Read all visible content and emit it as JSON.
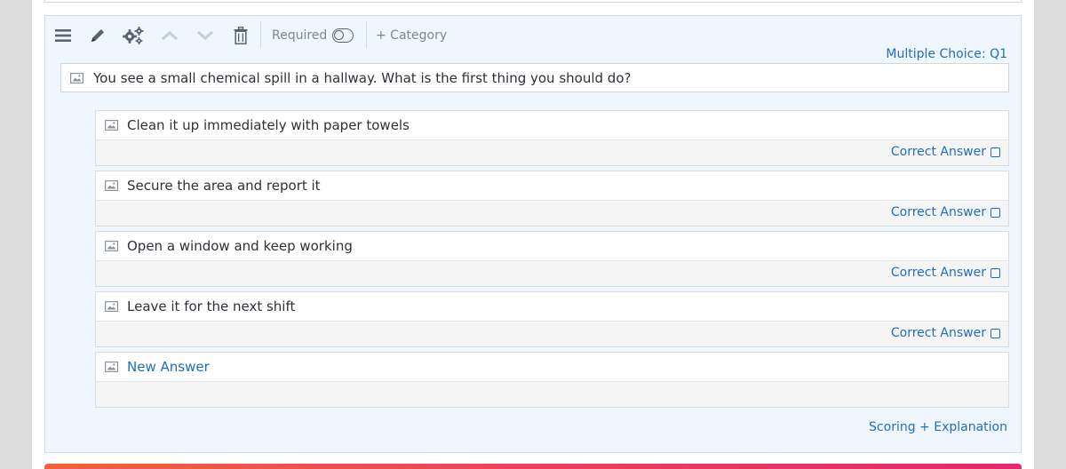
{
  "toolbar": {
    "icons": [
      "menu-icon",
      "pencil-icon",
      "gears-icon",
      "chevron-up-icon",
      "chevron-down-icon",
      "trash-icon"
    ],
    "required_label": "Required",
    "category_label": "+ Category"
  },
  "question": {
    "type_label": "Multiple Choice: Q1",
    "text": "You see a small chemical spill in a hallway. What is the first thing you should do?"
  },
  "answers": [
    {
      "text": "Clean it up immediately with paper towels",
      "correct_label": "Correct Answer"
    },
    {
      "text": "Secure the area and report it",
      "correct_label": "Correct Answer"
    },
    {
      "text": "Open a window and keep working",
      "correct_label": "Correct Answer"
    },
    {
      "text": "Leave it for the next shift",
      "correct_label": "Correct Answer"
    }
  ],
  "new_answer": {
    "placeholder": "New Answer"
  },
  "footer": {
    "scoring_label": "Scoring + Explanation"
  },
  "colors": {
    "accent_blue": "#1f6fc1",
    "card_background": "#eff6fd",
    "bottom_bar_gradient": [
      "#f2613a",
      "#e6276e"
    ]
  }
}
